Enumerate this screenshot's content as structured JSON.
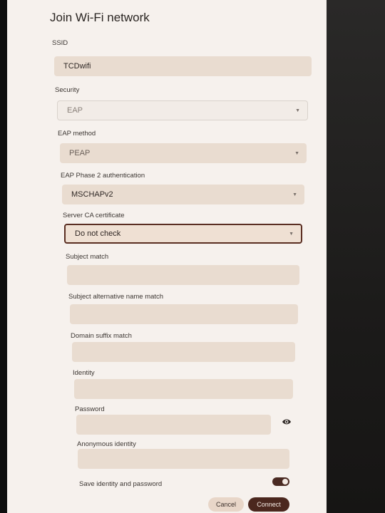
{
  "dialog": {
    "title": "Join Wi-Fi network"
  },
  "fields": {
    "ssid": {
      "label": "SSID",
      "value": "TCDwifi"
    },
    "security": {
      "label": "Security",
      "value": "EAP"
    },
    "eap_method": {
      "label": "EAP method",
      "value": "PEAP"
    },
    "phase2": {
      "label": "EAP Phase 2 authentication",
      "value": "MSCHAPv2"
    },
    "ca_cert": {
      "label": "Server CA certificate",
      "value": "Do not check"
    },
    "subject_match": {
      "label": "Subject match",
      "value": ""
    },
    "san_match": {
      "label": "Subject alternative name match",
      "value": ""
    },
    "domain_suffix": {
      "label": "Domain suffix match",
      "value": ""
    },
    "identity": {
      "label": "Identity",
      "value": ""
    },
    "password": {
      "label": "Password",
      "value": ""
    },
    "anon_identity": {
      "label": "Anonymous identity",
      "value": ""
    }
  },
  "save_identity": {
    "label": "Save identity and password",
    "on": true
  },
  "buttons": {
    "cancel": "Cancel",
    "connect": "Connect"
  },
  "icons": {
    "dropdown": "chevron-down-icon",
    "password_visibility": "eye-icon"
  },
  "colors": {
    "dialog_bg": "#f6f1ed",
    "field_bg": "#e9dcd0",
    "accent": "#4b271e"
  }
}
